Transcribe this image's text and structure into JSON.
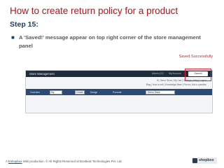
{
  "slide": {
    "title": "How to create return policy for a product",
    "step": "Step 15:",
    "bullet": "A 'Saved!' message appear on top right corner of the store management panel",
    "saved_note": "Saved Successfully"
  },
  "screenshot": {
    "app_title": "Store Management",
    "top_links": [
      "Admin (12)",
      "My Account"
    ],
    "saved_badge": "Saved!",
    "nav_line1": "Hi, Demo Store  |  My Cart  |  Settings  |  Help  |  Logout",
    "nav_line2": "Blog  |  How to sell  |  Knowledge Base  |  Forum  |  Ask a question",
    "toolbar": {
      "overview": "Overview",
      "select_1": "My",
      "create": "Create",
      "design": "Design",
      "promote": "Promote",
      "store": "Demo Store"
    }
  },
  "footer": {
    "prefix": "A",
    "link": "Eshopbox",
    "suffix": "Wiki production. © All Rights Reserved at BoxBeat Technologies Pvt. Ltd.",
    "logo_text": "shopbox"
  }
}
